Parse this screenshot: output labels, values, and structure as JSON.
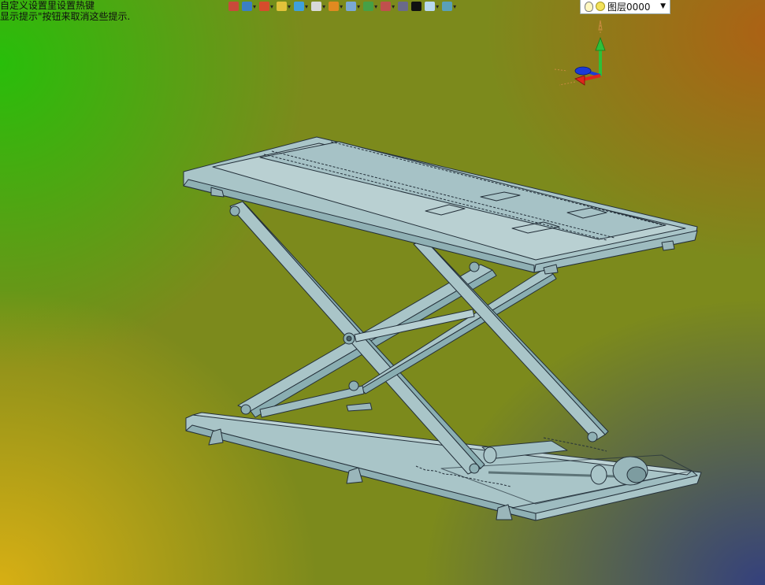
{
  "hints": {
    "line1": "自定义设置里设置热键",
    "line2": "显示提示\"按钮来取消这些提示."
  },
  "toolbar": {
    "items": [
      {
        "icon": "import-icon",
        "color": "#c84a3a"
      },
      {
        "icon": "view-orient-icon",
        "color": "#3b7fc4"
      },
      {
        "icon": "sketch-pen-icon",
        "color": "#d64c2c"
      },
      {
        "icon": "box-face-icon",
        "color": "#e2c23a"
      },
      {
        "icon": "cube-shaded-icon",
        "color": "#3fa0dc"
      },
      {
        "icon": "cube-wire-icon",
        "color": "#d8d8d8"
      },
      {
        "icon": "render-sphere-icon",
        "color": "#e08a20"
      },
      {
        "icon": "zoom-icon",
        "color": "#7aa8d4"
      },
      {
        "icon": "fit-view-icon",
        "color": "#46a046"
      },
      {
        "icon": "section-icon",
        "color": "#c0504d"
      },
      {
        "icon": "display-mode-icon",
        "color": "#6a6a8a"
      },
      {
        "icon": "line-style-icon",
        "color": "#111111"
      },
      {
        "icon": "color-swatch-icon",
        "color": "#b8d8ee"
      },
      {
        "icon": "material-icon",
        "color": "#5aa0b8"
      }
    ],
    "layer": {
      "label": "图层0000",
      "bulb_icon": "lightbulb-icon",
      "color_dot": "#f3e25a"
    }
  },
  "triad": {
    "x_color": "#e0261b",
    "y_color": "#2ec03a",
    "z_color": "#1a3ad8"
  },
  "model": {
    "name": "scissor-lift-table",
    "frame_color": "#a9c5c8",
    "edge_color": "#24303a"
  }
}
